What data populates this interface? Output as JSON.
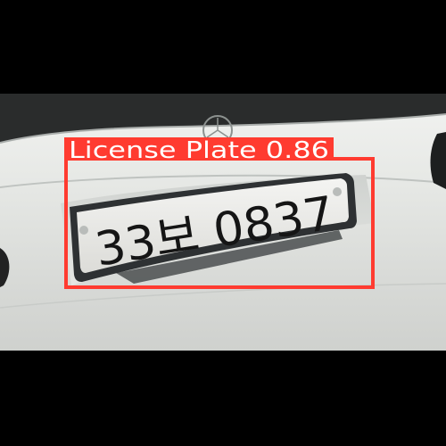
{
  "detection": {
    "class_label": "License Plate",
    "confidence": "0.86",
    "box_color": "#ff3b30",
    "label_text_color": "#ffffff"
  },
  "plate": {
    "text": "33보 0837"
  },
  "photo": {
    "background_color": "#000000",
    "car_color": "#e3e5e2"
  }
}
